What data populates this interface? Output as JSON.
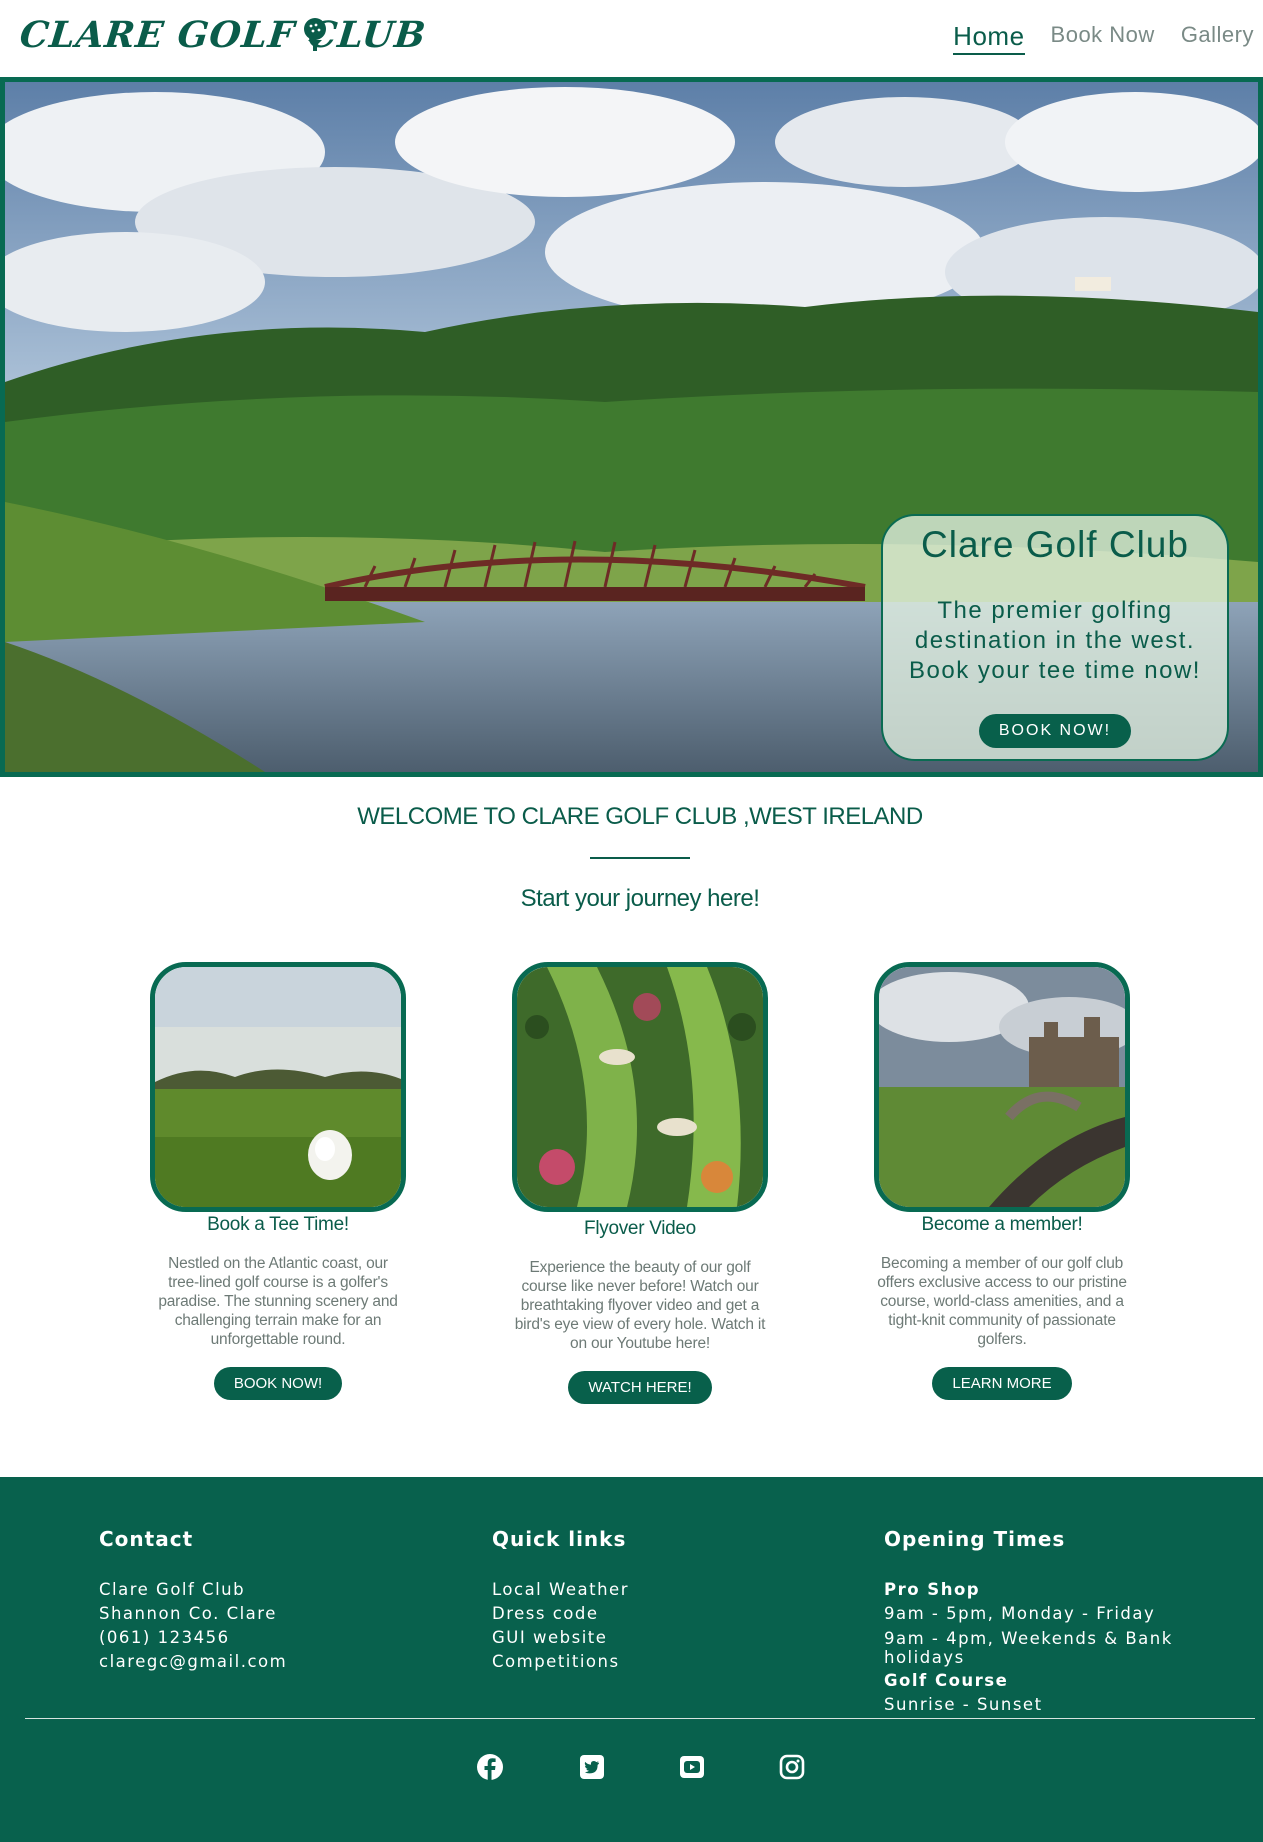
{
  "nav": {
    "logo": "CLARE GOLF CLUB",
    "logo_icon": "golf-ball-on-tee-icon",
    "links": [
      "Home",
      "Book Now",
      "Gallery"
    ]
  },
  "hero": {
    "title": "Clare Golf Club",
    "text": "The premier golfing destination in the west. Book your tee time now!",
    "button": "BOOK NOW!"
  },
  "welcome": {
    "heading": "WELCOME TO CLARE GOLF CLUB ,WEST IRELAND",
    "subtitle": "Start your journey here!"
  },
  "cards": [
    {
      "title": "Book a Tee Time!",
      "text": "Nestled on the Atlantic coast, our tree-lined golf course is a golfer's paradise. The stunning scenery and challenging terrain make for an unforgettable round.",
      "button": "BOOK NOW!"
    },
    {
      "title": "Flyover Video",
      "text": "Experience the beauty of our golf course like never before! Watch our breathtaking flyover video and get a bird's eye view of every hole. Watch it on our Youtube here!",
      "button": "WATCH HERE!"
    },
    {
      "title": "Become a member!",
      "text": "Becoming a member of our golf club offers exclusive access to our pristine course, world-class amenities, and a tight-knit community of passionate golfers.",
      "button": "LEARN MORE"
    }
  ],
  "footer": {
    "contact": {
      "heading": "Contact",
      "lines": [
        "Clare Golf Club",
        "Shannon Co. Clare",
        "(061) 123456",
        "claregc@gmail.com"
      ]
    },
    "quick_links": {
      "heading": "Quick links",
      "links": [
        "Local Weather",
        "Dress code",
        "GUI website",
        "Competitions"
      ]
    },
    "opening_times": {
      "heading": "Opening Times",
      "pro_shop_label": "Pro Shop",
      "pro_shop_weekday": "9am - 5pm, Monday - Friday",
      "pro_shop_weekend": "9am - 4pm, Weekends & Bank holidays",
      "course_label": "Golf Course",
      "course_hours": "Sunrise - Sunset"
    },
    "social_icons": [
      "facebook-icon",
      "twitter-icon",
      "youtube-icon",
      "instagram-icon"
    ]
  },
  "colors": {
    "brand_green": "#08604b",
    "text_grey": "#6d7a76",
    "white": "#ffffff"
  }
}
